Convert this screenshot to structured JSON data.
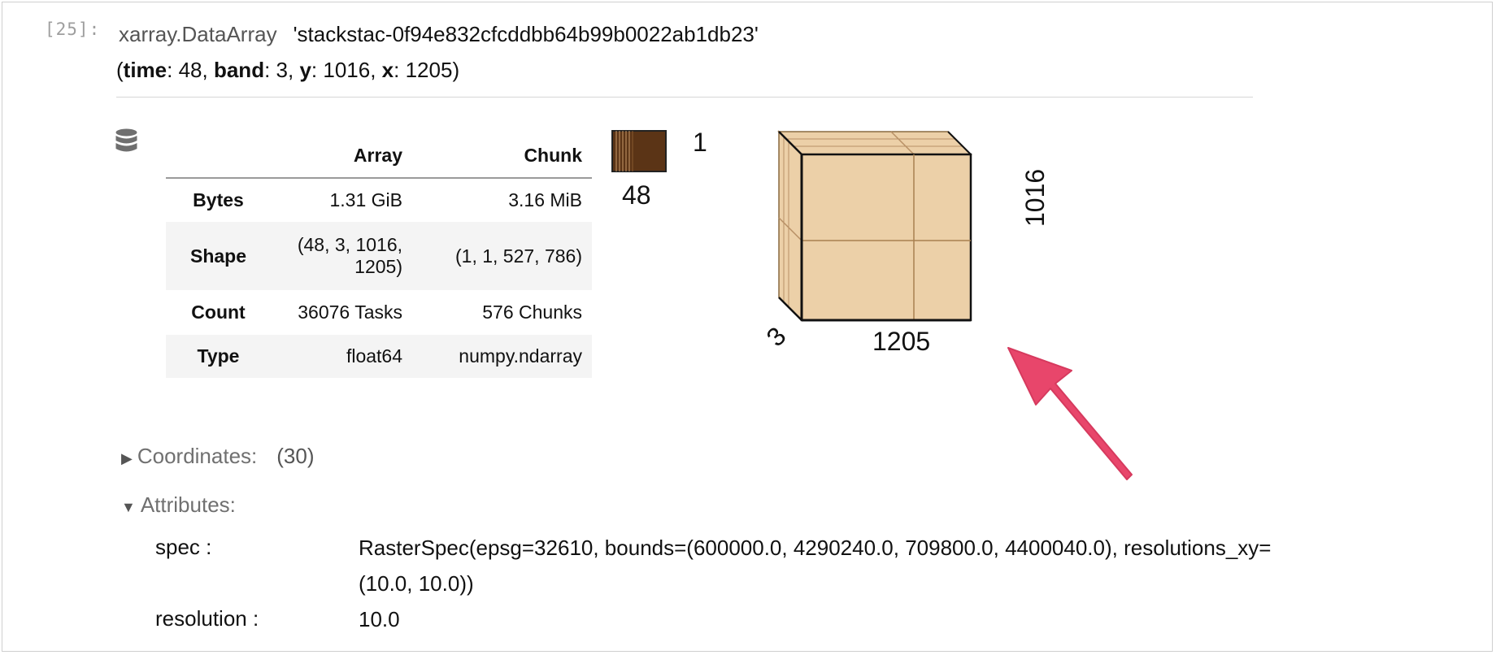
{
  "cell": {
    "prompt": "[25]:"
  },
  "header": {
    "obj_type": "xarray.DataArray",
    "obj_name": "'stackstac-0f94e832cfcddbb64b99b0022ab1db23'",
    "dims": [
      {
        "name": "time",
        "size": "48"
      },
      {
        "name": "band",
        "size": "3"
      },
      {
        "name": "y",
        "size": "1016"
      },
      {
        "name": "x",
        "size": "1205"
      }
    ]
  },
  "array_table": {
    "columns": [
      "",
      "Array",
      "Chunk"
    ],
    "rows": [
      {
        "label": "Bytes",
        "array": "1.31 GiB",
        "chunk": "3.16 MiB"
      },
      {
        "label": "Shape",
        "array": "(48, 3, 1016, 1205)",
        "chunk": "(1, 1, 527, 786)"
      },
      {
        "label": "Count",
        "array": "36076 Tasks",
        "chunk": "576 Chunks"
      },
      {
        "label": "Type",
        "array": "float64",
        "chunk": "numpy.ndarray"
      }
    ]
  },
  "chunk_diagram": {
    "mini_label_side": "1",
    "mini_label_bottom": "48",
    "cube_label_y": "1016",
    "cube_label_x": "1205",
    "cube_label_band": "3",
    "colors": {
      "mini_fill": "#5b3416",
      "cube_fill": "#ecd0a8",
      "arrow": "#e8466b"
    }
  },
  "sections": {
    "coordinates_label": "Coordinates:",
    "coordinates_count": "(30)",
    "attributes_label": "Attributes:"
  },
  "attributes": [
    {
      "key": "spec :",
      "value": "RasterSpec(epsg=32610, bounds=(600000.0, 4290240.0, 709800.0, 4400040.0), resolutions_xy=(10.0, 10.0))"
    },
    {
      "key": "resolution :",
      "value": "10.0"
    }
  ]
}
